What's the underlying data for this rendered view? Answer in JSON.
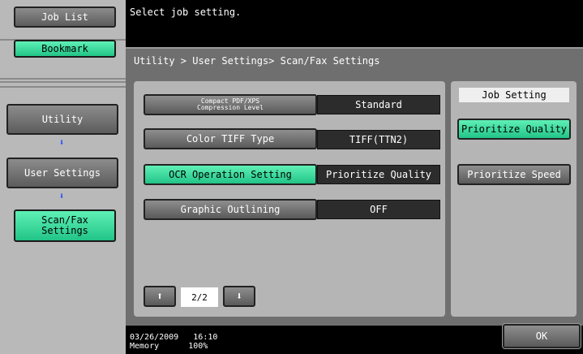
{
  "sidebar": {
    "job_list": "Job List",
    "bookmark": "Bookmark",
    "utility": "Utility",
    "user_settings": "User Settings",
    "scan_fax_line1": "Scan/Fax",
    "scan_fax_line2": "Settings",
    "arrow": "⬇"
  },
  "message": "Select job setting.",
  "breadcrumb": "Utility > User Settings> Scan/Fax Settings",
  "settings": [
    {
      "label_line1": "Compact PDF/XPS",
      "label_line2": "Compression Level",
      "value": "Standard"
    },
    {
      "label": "Color TIFF Type",
      "value": "TIFF(TTN2)"
    },
    {
      "label": "OCR Operation Setting",
      "value": "Prioritize Quality"
    },
    {
      "label": "Graphic Outlining",
      "value": "OFF"
    }
  ],
  "pagination": {
    "page": "2/2",
    "up": "⬆",
    "down": "⬇"
  },
  "job_setting": {
    "header": "Job Setting",
    "prioritize_quality": "Prioritize Quality",
    "prioritize_speed": "Prioritize Speed"
  },
  "footer": {
    "date": "03/26/2009",
    "time": "16:10",
    "memory_label": "Memory",
    "memory_value": "100%"
  },
  "ok_label": "OK",
  "colors": {
    "accent_green": "#3ddc9e",
    "arrow_blue": "#1f4fff"
  }
}
